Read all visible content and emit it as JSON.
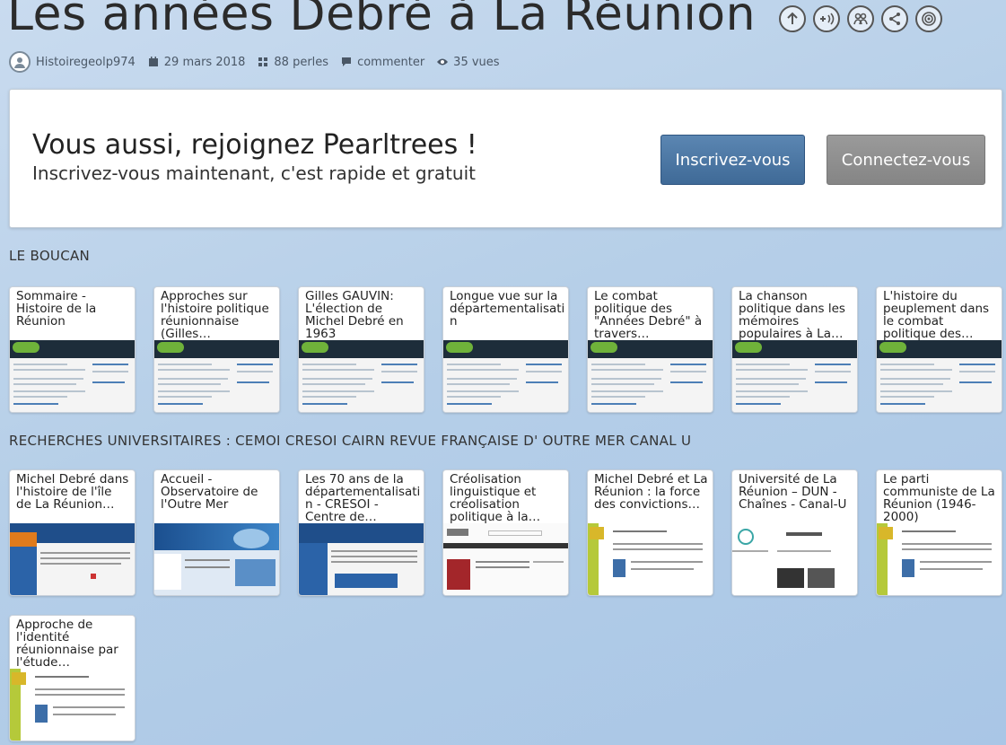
{
  "header": {
    "title": "Les années Debré à La Réunion",
    "icons": [
      "arrow-up-icon",
      "add-sound-icon",
      "team-icon",
      "share-icon",
      "target-icon"
    ]
  },
  "meta": {
    "author": "Histoiregeolp974",
    "date": "29 mars 2018",
    "pearls": "88 perles",
    "comment": "commenter",
    "views": "35 vues"
  },
  "join": {
    "title": "Vous aussi, rejoignez Pearltrees !",
    "subtitle": "Inscrivez-vous maintenant, c'est rapide et gratuit",
    "signup_label": "Inscrivez-vous",
    "login_label": "Connectez-vous"
  },
  "sections": [
    {
      "title": "LE BOUCAN",
      "cards": [
        {
          "title": "Sommaire - Histoire de la Réunion",
          "thumb": "boucan"
        },
        {
          "title": "Approches sur l'histoire politique réunionnaise (Gilles…",
          "thumb": "boucan"
        },
        {
          "title": "Gilles GAUVIN: L'élection de Michel Debré en 1963",
          "thumb": "boucan"
        },
        {
          "title": "Longue vue sur la départementalisatio n",
          "thumb": "boucan"
        },
        {
          "title": "Le combat politique des \"Années Debré\" à travers…",
          "thumb": "boucan"
        },
        {
          "title": "La chanson politique dans les mémoires populaires à La…",
          "thumb": "boucan"
        },
        {
          "title": "L'histoire du peuplement dans le combat politique des…",
          "thumb": "boucan"
        }
      ]
    },
    {
      "title": "RECHERCHES UNIVERSITAIRES : CEMOI CRESOI CAIRN REVUE FRANÇAISE D' OUTRE MER CANAL U",
      "cards": [
        {
          "title": "Michel Debré dans l'histoire de l'île de La Réunion…",
          "thumb": "cemoi"
        },
        {
          "title": "Accueil - Observatoire de l'Outre Mer",
          "thumb": "observatoire"
        },
        {
          "title": "Les 70 ans de la départementalisatio n - CRESOI - Centre de…",
          "thumb": "cresoi"
        },
        {
          "title": "Créolisation linguistique et créolisation politique à la…",
          "thumb": "cairn"
        },
        {
          "title": "Michel Debré et La Réunion : la force des convictions…",
          "thumb": "rfom"
        },
        {
          "title": "Université de La Réunion – DUN - Chaînes - Canal-U",
          "thumb": "canalu"
        },
        {
          "title": "Le parti communiste de La Réunion (1946-2000)",
          "thumb": "rfom"
        },
        {
          "title": "Approche de l'identité réunionnaise par l'étude…",
          "thumb": "rfom"
        }
      ]
    }
  ]
}
